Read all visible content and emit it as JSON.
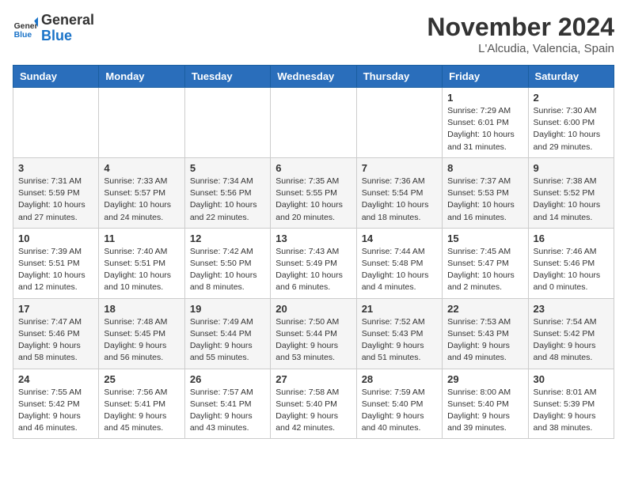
{
  "logo": {
    "line1": "General",
    "line2": "Blue"
  },
  "title": "November 2024",
  "location": "L'Alcudia, Valencia, Spain",
  "days_of_week": [
    "Sunday",
    "Monday",
    "Tuesday",
    "Wednesday",
    "Thursday",
    "Friday",
    "Saturday"
  ],
  "weeks": [
    [
      {
        "day": "",
        "info": ""
      },
      {
        "day": "",
        "info": ""
      },
      {
        "day": "",
        "info": ""
      },
      {
        "day": "",
        "info": ""
      },
      {
        "day": "",
        "info": ""
      },
      {
        "day": "1",
        "info": "Sunrise: 7:29 AM\nSunset: 6:01 PM\nDaylight: 10 hours and 31 minutes."
      },
      {
        "day": "2",
        "info": "Sunrise: 7:30 AM\nSunset: 6:00 PM\nDaylight: 10 hours and 29 minutes."
      }
    ],
    [
      {
        "day": "3",
        "info": "Sunrise: 7:31 AM\nSunset: 5:59 PM\nDaylight: 10 hours and 27 minutes."
      },
      {
        "day": "4",
        "info": "Sunrise: 7:33 AM\nSunset: 5:57 PM\nDaylight: 10 hours and 24 minutes."
      },
      {
        "day": "5",
        "info": "Sunrise: 7:34 AM\nSunset: 5:56 PM\nDaylight: 10 hours and 22 minutes."
      },
      {
        "day": "6",
        "info": "Sunrise: 7:35 AM\nSunset: 5:55 PM\nDaylight: 10 hours and 20 minutes."
      },
      {
        "day": "7",
        "info": "Sunrise: 7:36 AM\nSunset: 5:54 PM\nDaylight: 10 hours and 18 minutes."
      },
      {
        "day": "8",
        "info": "Sunrise: 7:37 AM\nSunset: 5:53 PM\nDaylight: 10 hours and 16 minutes."
      },
      {
        "day": "9",
        "info": "Sunrise: 7:38 AM\nSunset: 5:52 PM\nDaylight: 10 hours and 14 minutes."
      }
    ],
    [
      {
        "day": "10",
        "info": "Sunrise: 7:39 AM\nSunset: 5:51 PM\nDaylight: 10 hours and 12 minutes."
      },
      {
        "day": "11",
        "info": "Sunrise: 7:40 AM\nSunset: 5:51 PM\nDaylight: 10 hours and 10 minutes."
      },
      {
        "day": "12",
        "info": "Sunrise: 7:42 AM\nSunset: 5:50 PM\nDaylight: 10 hours and 8 minutes."
      },
      {
        "day": "13",
        "info": "Sunrise: 7:43 AM\nSunset: 5:49 PM\nDaylight: 10 hours and 6 minutes."
      },
      {
        "day": "14",
        "info": "Sunrise: 7:44 AM\nSunset: 5:48 PM\nDaylight: 10 hours and 4 minutes."
      },
      {
        "day": "15",
        "info": "Sunrise: 7:45 AM\nSunset: 5:47 PM\nDaylight: 10 hours and 2 minutes."
      },
      {
        "day": "16",
        "info": "Sunrise: 7:46 AM\nSunset: 5:46 PM\nDaylight: 10 hours and 0 minutes."
      }
    ],
    [
      {
        "day": "17",
        "info": "Sunrise: 7:47 AM\nSunset: 5:46 PM\nDaylight: 9 hours and 58 minutes."
      },
      {
        "day": "18",
        "info": "Sunrise: 7:48 AM\nSunset: 5:45 PM\nDaylight: 9 hours and 56 minutes."
      },
      {
        "day": "19",
        "info": "Sunrise: 7:49 AM\nSunset: 5:44 PM\nDaylight: 9 hours and 55 minutes."
      },
      {
        "day": "20",
        "info": "Sunrise: 7:50 AM\nSunset: 5:44 PM\nDaylight: 9 hours and 53 minutes."
      },
      {
        "day": "21",
        "info": "Sunrise: 7:52 AM\nSunset: 5:43 PM\nDaylight: 9 hours and 51 minutes."
      },
      {
        "day": "22",
        "info": "Sunrise: 7:53 AM\nSunset: 5:43 PM\nDaylight: 9 hours and 49 minutes."
      },
      {
        "day": "23",
        "info": "Sunrise: 7:54 AM\nSunset: 5:42 PM\nDaylight: 9 hours and 48 minutes."
      }
    ],
    [
      {
        "day": "24",
        "info": "Sunrise: 7:55 AM\nSunset: 5:42 PM\nDaylight: 9 hours and 46 minutes."
      },
      {
        "day": "25",
        "info": "Sunrise: 7:56 AM\nSunset: 5:41 PM\nDaylight: 9 hours and 45 minutes."
      },
      {
        "day": "26",
        "info": "Sunrise: 7:57 AM\nSunset: 5:41 PM\nDaylight: 9 hours and 43 minutes."
      },
      {
        "day": "27",
        "info": "Sunrise: 7:58 AM\nSunset: 5:40 PM\nDaylight: 9 hours and 42 minutes."
      },
      {
        "day": "28",
        "info": "Sunrise: 7:59 AM\nSunset: 5:40 PM\nDaylight: 9 hours and 40 minutes."
      },
      {
        "day": "29",
        "info": "Sunrise: 8:00 AM\nSunset: 5:40 PM\nDaylight: 9 hours and 39 minutes."
      },
      {
        "day": "30",
        "info": "Sunrise: 8:01 AM\nSunset: 5:39 PM\nDaylight: 9 hours and 38 minutes."
      }
    ]
  ]
}
